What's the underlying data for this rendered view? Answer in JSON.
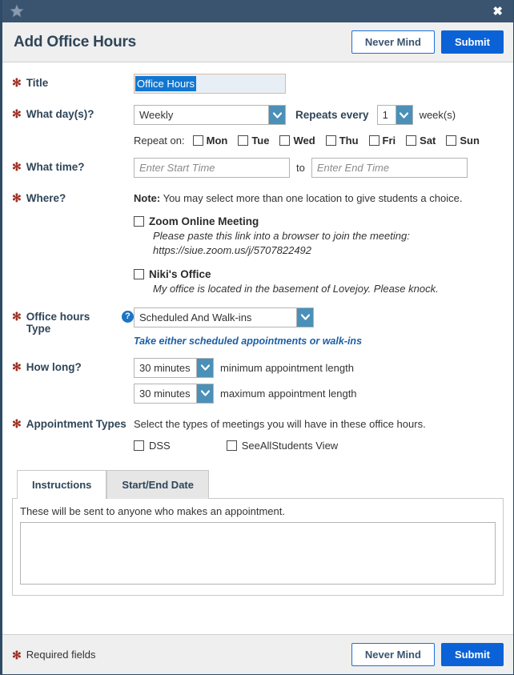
{
  "titlebar": {
    "star_icon": "star-icon",
    "close_label": "✖"
  },
  "header": {
    "title": "Add Office Hours",
    "never_mind_label": "Never Mind",
    "submit_label": "Submit"
  },
  "form": {
    "title_field": {
      "label": "Title",
      "value": "Office Hours",
      "selected_text": "Office Hours"
    },
    "day_field": {
      "label": "What day(s)?",
      "recurrence_value": "Weekly",
      "repeats_every_label": "Repeats every",
      "repeats_count": "1",
      "repeats_unit_label": "week(s)",
      "repeat_on_label": "Repeat on:",
      "days": [
        {
          "label": "Mon",
          "checked": false
        },
        {
          "label": "Tue",
          "checked": false
        },
        {
          "label": "Wed",
          "checked": false
        },
        {
          "label": "Thu",
          "checked": false
        },
        {
          "label": "Fri",
          "checked": false
        },
        {
          "label": "Sat",
          "checked": false
        },
        {
          "label": "Sun",
          "checked": false
        }
      ]
    },
    "time_field": {
      "label": "What time?",
      "start_placeholder": "Enter Start Time",
      "start_value": "",
      "to_label": "to",
      "end_placeholder": "Enter End Time",
      "end_value": ""
    },
    "where_field": {
      "label": "Where?",
      "note_bold": "Note:",
      "note_text": " You may select more than one location to give students a choice.",
      "locations": [
        {
          "name": "Zoom Online Meeting",
          "description": "Please paste this link into a browser to join the meeting: https://siue.zoom.us/j/5707822492",
          "checked": false
        },
        {
          "name": "Niki's Office",
          "description": "My office is located in the basement of Lovejoy. Please knock.",
          "checked": false
        }
      ]
    },
    "office_hours_type": {
      "label": "Office hours Type",
      "help_icon": "help-icon",
      "value": "Scheduled And Walk-ins",
      "hint": "Take either scheduled appointments or walk-ins"
    },
    "how_long": {
      "label": "How long?",
      "min_value": "30 minutes",
      "min_caption": "minimum appointment length",
      "max_value": "30 minutes",
      "max_caption": "maximum appointment length"
    },
    "appointment_types": {
      "label": "Appointment Types",
      "description": "Select the types of meetings you will have in these office hours.",
      "options": [
        {
          "label": "DSS",
          "checked": false
        },
        {
          "label": "SeeAllStudents View",
          "checked": false
        }
      ]
    },
    "tabs": [
      {
        "label": "Instructions",
        "active": true
      },
      {
        "label": "Start/End Date",
        "active": false
      }
    ],
    "instructions_panel": {
      "note": "These will be sent to anyone who makes an appointment.",
      "textarea_value": ""
    }
  },
  "footer": {
    "required_note": "Required fields",
    "never_mind_label": "Never Mind",
    "submit_label": "Submit"
  },
  "colors": {
    "titlebar": "#3a5470",
    "header_bg": "#efefef",
    "primary_blue": "#0b62d6",
    "accent_blue": "#4a90b8",
    "required_red": "#9e2a1e",
    "hint_blue": "#1c5fa8",
    "selection_blue": "#1177d1"
  }
}
